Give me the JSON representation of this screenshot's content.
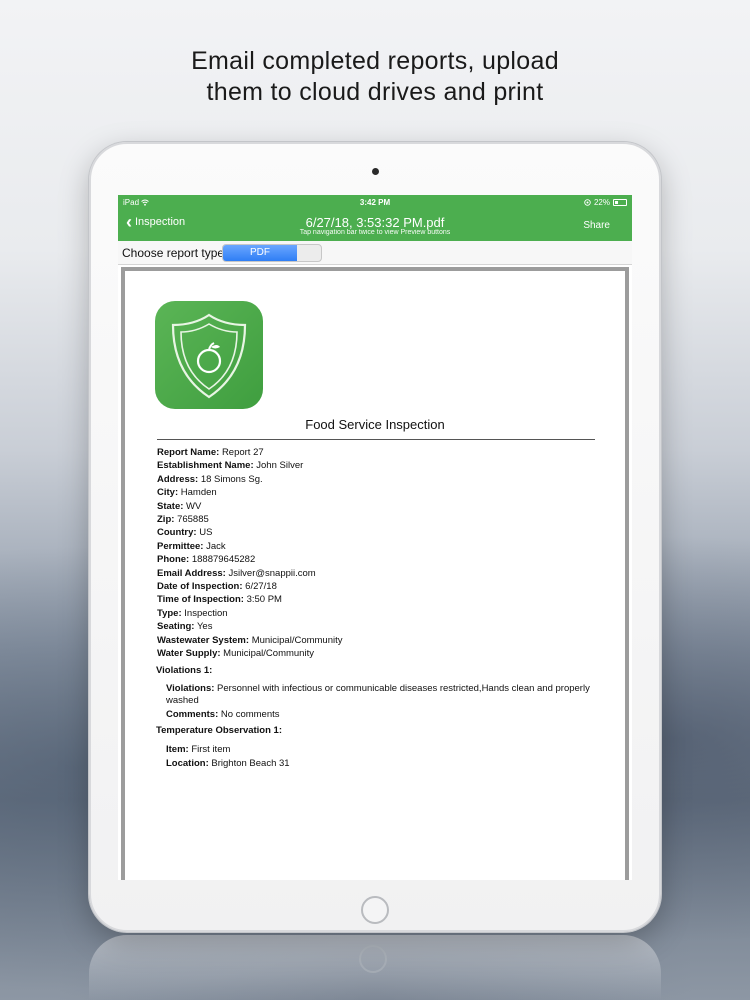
{
  "headline": {
    "line1": "Email completed reports, upload",
    "line2": "them to cloud drives and print"
  },
  "status_bar": {
    "device": "iPad",
    "time": "3:42 PM",
    "battery": "22%",
    "icons": [
      "wifi-icon",
      "location-icon",
      "battery-icon"
    ]
  },
  "navbar": {
    "back_label": "Inspection",
    "title": "6/27/18, 3:53:32 PM.pdf",
    "subtitle": "Tap navigation bar twice to view Preview buttons",
    "share_label": "Share",
    "color": "#4cae4f"
  },
  "report_type": {
    "label": "Choose report type",
    "selected": "PDF",
    "accent": "#2f7ef5"
  },
  "document": {
    "title": "Food Service Inspection",
    "fields": [
      {
        "label": "Report Name:",
        "value": "Report 27"
      },
      {
        "label": "Establishment Name:",
        "value": "John Silver"
      },
      {
        "label": "Address:",
        "value": "18 Simons Sg."
      },
      {
        "label": "City:",
        "value": "Hamden"
      },
      {
        "label": "State:",
        "value": "WV"
      },
      {
        "label": "Zip:",
        "value": "765885"
      },
      {
        "label": "Country:",
        "value": "US"
      },
      {
        "label": "Permittee:",
        "value": "Jack"
      },
      {
        "label": "Phone:",
        "value": "188879645282"
      },
      {
        "label": "Email Address:",
        "value": "Jsilver@snappii.com"
      },
      {
        "label": "Date of Inspection:",
        "value": "6/27/18"
      },
      {
        "label": "Time of Inspection:",
        "value": "3:50 PM"
      },
      {
        "label": "Type:",
        "value": "Inspection"
      },
      {
        "label": "Seating:",
        "value": "Yes"
      },
      {
        "label": "Wastewater System:",
        "value": "Municipal/Community"
      },
      {
        "label": "Water Supply:",
        "value": "Municipal/Community"
      }
    ],
    "violations": {
      "heading": "Violations 1:",
      "items": [
        {
          "label": "Violations:",
          "value": "Personnel with infectious or communicable diseases restricted,Hands clean and properly washed"
        },
        {
          "label": "Comments:",
          "value": "No comments"
        }
      ]
    },
    "temperature": {
      "heading": "Temperature Observation 1:",
      "items": [
        {
          "label": "Item:",
          "value": "First item"
        },
        {
          "label": "Location:",
          "value": "Brighton Beach 31"
        }
      ]
    },
    "logo_color": "#43a343"
  }
}
